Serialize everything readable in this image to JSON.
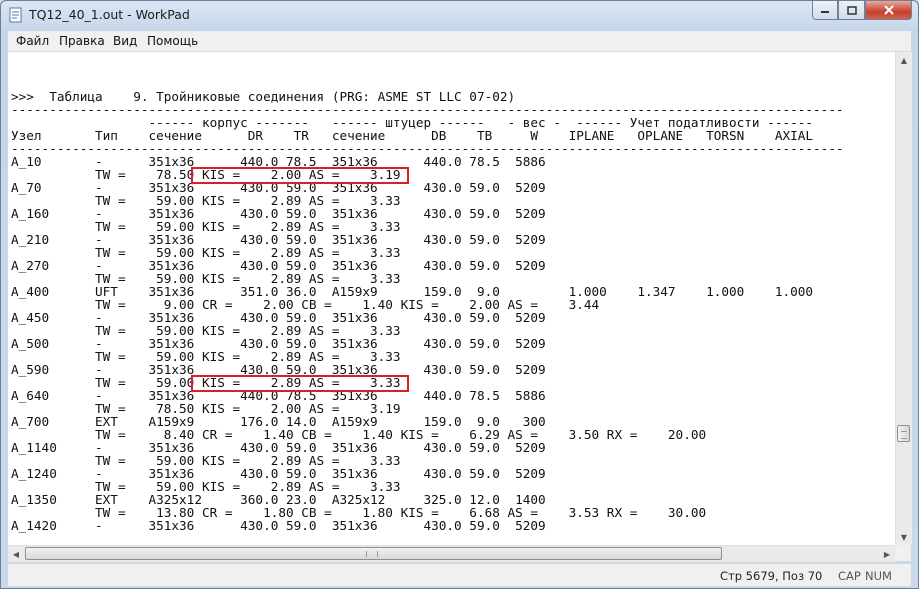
{
  "window": {
    "title": "TQ12_40_1.out - WorkPad",
    "min_icon": "minimize-icon",
    "max_icon": "maximize-icon",
    "close_icon": "close-icon"
  },
  "menu": [
    {
      "label": "Файл"
    },
    {
      "label": "Правка"
    },
    {
      "label": "Вид"
    },
    {
      "label": "Помощь"
    }
  ],
  "document": {
    "lines": [
      ">>>  Таблица    9. Тройниковые соединения (PRG: ASME ST LLC 07-02)",
      "-------------------------------------------------------------------------------------------------------------",
      "                  ------ корпус -------   ------ штуцер ------   - вес -  ------ Учет податливости ------",
      "Узел       Тип    сечение      DR    TR   сечение      DB    TB     W    IPLANE   OPLANE   TORSN    AXIAL",
      "-------------------------------------------------------------------------------------------------------------",
      "A_10       -      351x36      440.0 78.5  351x36      440.0 78.5  5886",
      "           TW =    78.50 KIS =    2.00 AS =    3.19",
      "A_70       -      351x36      430.0 59.0  351x36      430.0 59.0  5209",
      "           TW =    59.00 KIS =    2.89 AS =    3.33",
      "A_160      -      351x36      430.0 59.0  351x36      430.0 59.0  5209",
      "           TW =    59.00 KIS =    2.89 AS =    3.33",
      "A_210      -      351x36      430.0 59.0  351x36      430.0 59.0  5209",
      "           TW =    59.00 KIS =    2.89 AS =    3.33",
      "A_270      -      351x36      430.0 59.0  351x36      430.0 59.0  5209",
      "           TW =    59.00 KIS =    2.89 AS =    3.33",
      "A_400      UFT    351x36      351.0 36.0  A159x9      159.0  9.0         1.000    1.347    1.000    1.000",
      "           TW =     9.00 CR =    2.00 CB =    1.40 KIS =    2.00 AS =    3.44",
      "A_450      -      351x36      430.0 59.0  351x36      430.0 59.0  5209",
      "           TW =    59.00 KIS =    2.89 AS =    3.33",
      "A_500      -      351x36      430.0 59.0  351x36      430.0 59.0  5209",
      "           TW =    59.00 KIS =    2.89 AS =    3.33",
      "A_590      -      351x36      430.0 59.0  351x36      430.0 59.0  5209",
      "           TW =    59.00 KIS =    2.89 AS =    3.33",
      "A_640      -      351x36      440.0 78.5  351x36      440.0 78.5  5886",
      "           TW =    78.50 KIS =    2.00 AS =    3.19",
      "A_700      EXT    A159x9      176.0 14.0  A159x9      159.0  9.0   300",
      "           TW =     8.40 CR =    1.40 CB =    1.40 KIS =    6.29 AS =    3.50 RX =    20.00",
      "A_1140     -      351x36      430.0 59.0  351x36      430.0 59.0  5209",
      "           TW =    59.00 KIS =    2.89 AS =    3.33",
      "A_1240     -      351x36      430.0 59.0  351x36      430.0 59.0  5209",
      "           TW =    59.00 KIS =    2.89 AS =    3.33",
      "A_1350     EXT    A325x12     360.0 23.0  A325x12     325.0 12.0  1400",
      "           TW =    13.80 CR =    1.80 CB =    1.80 KIS =    6.68 AS =    3.53 RX =    30.00",
      "A_1420     -      351x36      430.0 59.0  351x36      430.0 59.0  5209"
    ]
  },
  "status": {
    "position": "Стр 5679, Поз 70",
    "cap": "CAP",
    "num": "NUM"
  },
  "highlight_color": "#d7212a"
}
